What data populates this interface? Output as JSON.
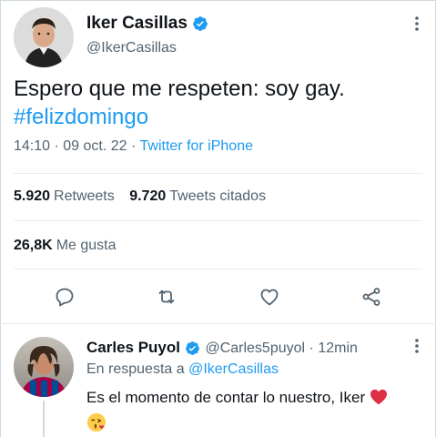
{
  "main_tweet": {
    "author_name": "Iker Casillas",
    "author_handle": "@IkerCasillas",
    "text": "Espero que me respeten: soy gay.",
    "hashtag": "#felizdomingo",
    "time": "14:10",
    "separator": "·",
    "date": "09 oct. 22",
    "source": "Twitter for iPhone",
    "retweets_count": "5.920",
    "retweets_label": "Retweets",
    "quotes_count": "9.720",
    "quotes_label": "Tweets citados",
    "likes_count": "26,8K",
    "likes_label": "Me gusta"
  },
  "actions": {
    "reply_icon": "reply-icon",
    "retweet_icon": "retweet-icon",
    "like_icon": "heart-icon",
    "share_icon": "share-icon"
  },
  "reply_tweet": {
    "author_name": "Carles Puyol",
    "author_handle": "@Carles5puyol",
    "separator": "·",
    "time": "12min",
    "reply_prefix": "En respuesta a",
    "reply_mention": "@IkerCasillas",
    "text": "Es el momento de contar lo nuestro, Iker"
  },
  "colors": {
    "accent": "#1d9bf0",
    "secondary_text": "#536471",
    "heart": "#e0245e"
  }
}
